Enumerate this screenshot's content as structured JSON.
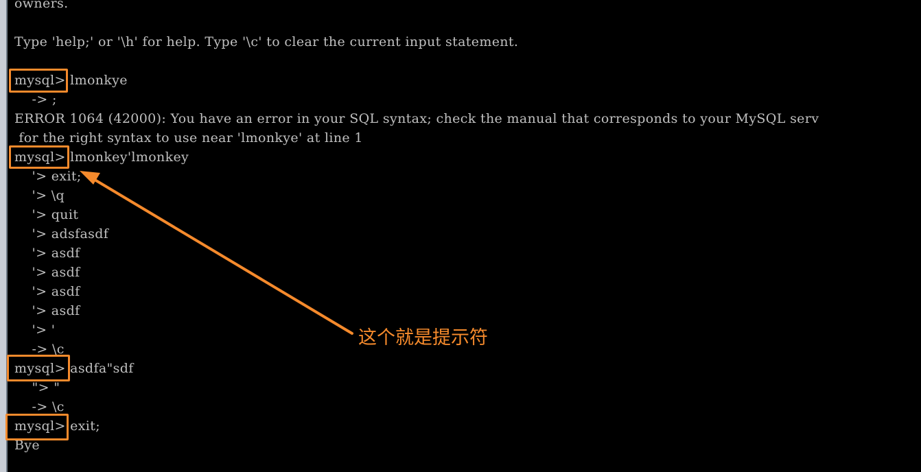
{
  "terminal": {
    "lines": [
      "owners.",
      "",
      "Type 'help;' or '\\h' for help. Type '\\c' to clear the current input statement.",
      "",
      "mysql> lmonkye",
      "    -> ;",
      "ERROR 1064 (42000): You have an error in your SQL syntax; check the manual that corresponds to your MySQL serv",
      " for the right syntax to use near 'lmonkye' at line 1",
      "mysql> lmonkey'lmonkey",
      "    '> exit;",
      "    '> \\q",
      "    '> quit",
      "    '> adsfasdf",
      "    '> asdf",
      "    '> asdf",
      "    '> asdf",
      "    '> asdf",
      "    '> '",
      "    -> \\c",
      "mysql> asdfa\"sdf",
      "    \"> \"",
      "    -> \\c",
      "mysql> exit;",
      "Bye"
    ]
  },
  "annotation": {
    "label": "这个就是提示符",
    "color": "#f58a2c"
  },
  "colors": {
    "background": "#000000",
    "text": "#c0c0c0",
    "highlight": "#f58a2c"
  }
}
